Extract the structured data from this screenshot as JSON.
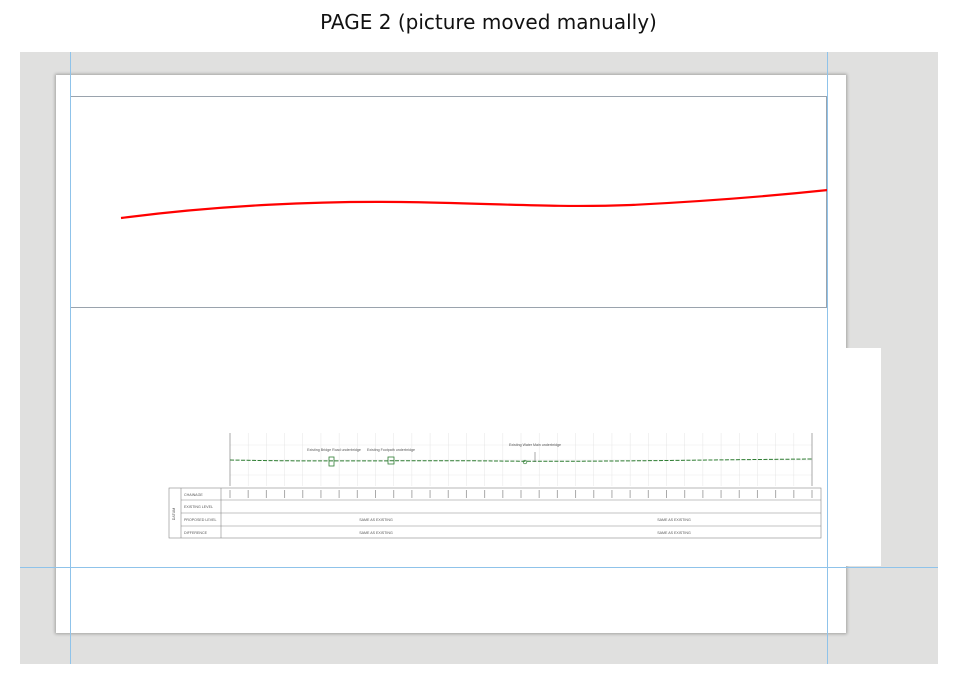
{
  "caption": "PAGE 2 (picture moved manually)",
  "colors": {
    "workspace": "#e0e0df",
    "guide": "#8fc3ea",
    "curve": "#ff0000",
    "profile": "#2e7d32"
  },
  "profile": {
    "annotations": [
      "Existing Bridge Road underbridge",
      "Existing Footpath underbridge",
      "Existing Water Main underbridge"
    ],
    "datum_label": "DATUM",
    "rows": [
      {
        "label": "CHAINAGE",
        "left": "",
        "right": ""
      },
      {
        "label": "EXISTING LEVEL",
        "left": "",
        "right": ""
      },
      {
        "label": "PROPOSED LEVEL",
        "left": "SAME AS EXISTING",
        "right": "SAME AS EXISTING"
      },
      {
        "label": "DIFFERENCE",
        "left": "SAME AS EXISTING",
        "right": "SAME AS EXISTING"
      }
    ]
  }
}
